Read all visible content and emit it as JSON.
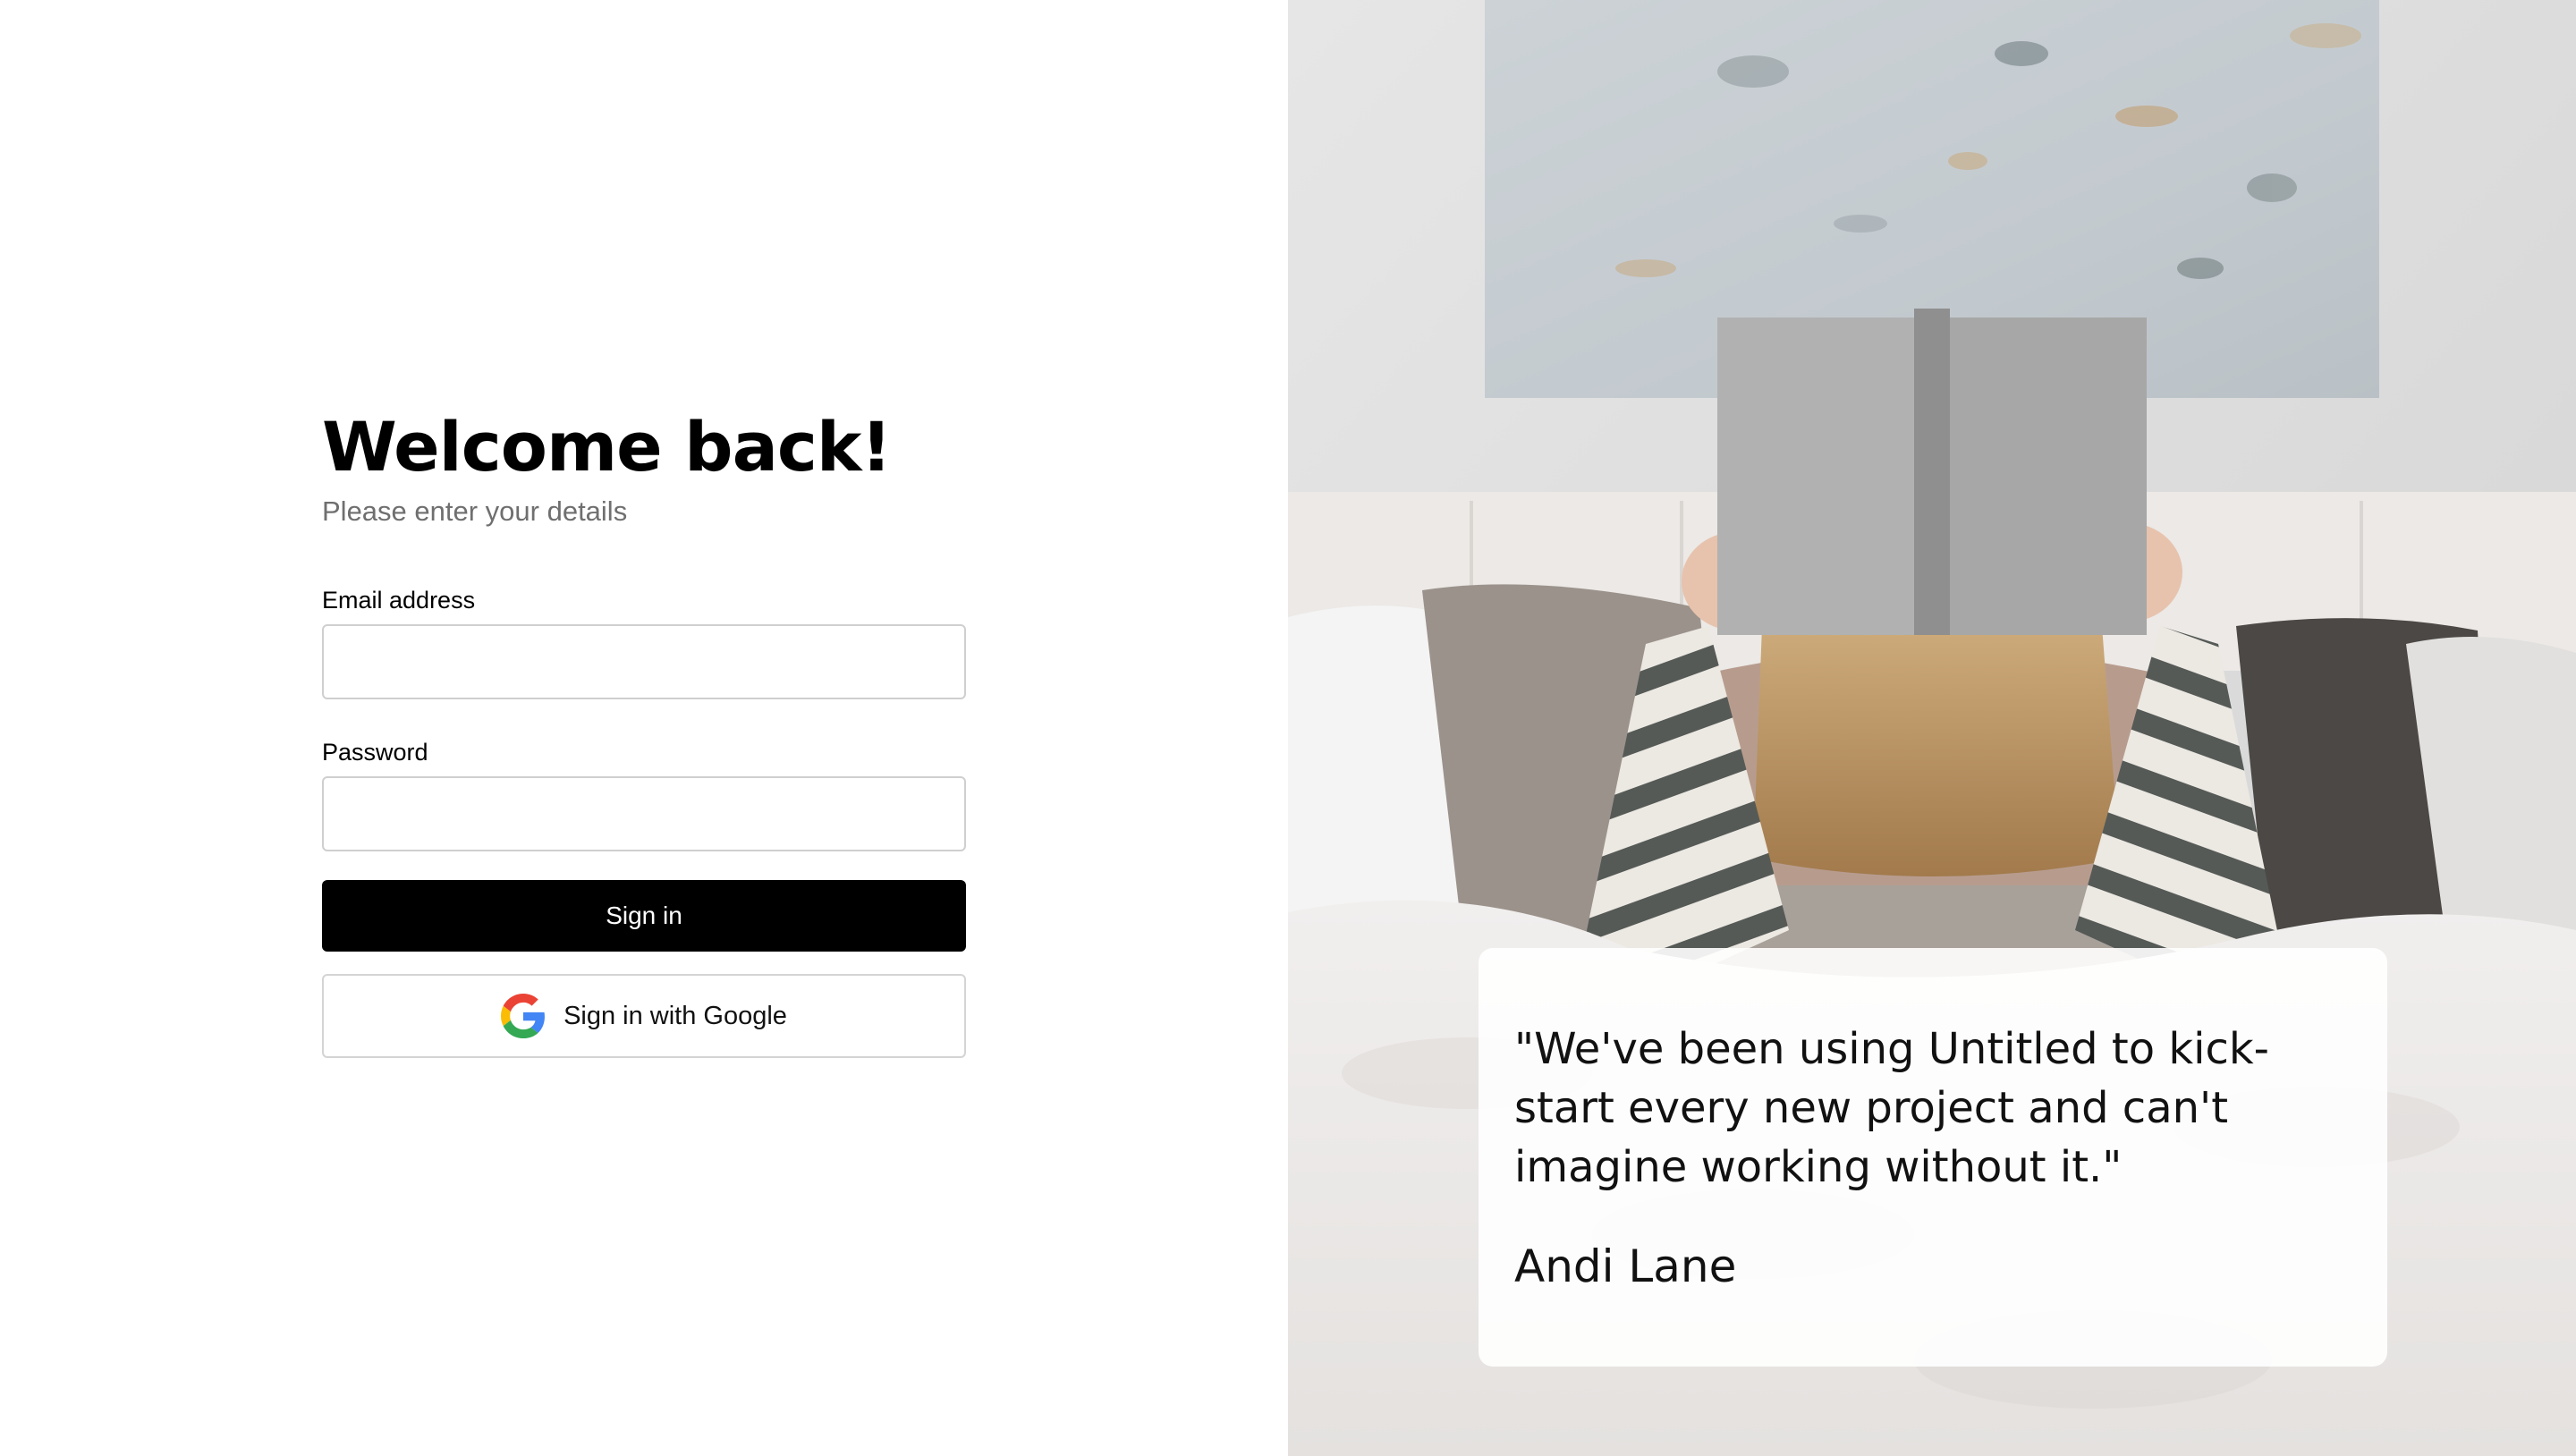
{
  "login": {
    "title": "Welcome back!",
    "subtitle": "Please enter your details",
    "email_label": "Email address",
    "email_value": "",
    "password_label": "Password",
    "password_value": "",
    "sign_in_label": "Sign in",
    "google_label": "Sign in with Google",
    "google_icon": "google-logo-icon"
  },
  "testimonial": {
    "quote": "\"We've been using Untitled to kick-start every new project and can't imagine working without it.\"",
    "author": "Andi Lane"
  },
  "hero_image": {
    "subject": "woman-reading-book-in-bed"
  },
  "colors": {
    "primary_button": "#000000",
    "subtitle_text": "#6f6f6f",
    "input_border": "#cfcfcf"
  }
}
